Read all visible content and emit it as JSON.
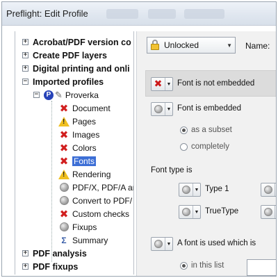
{
  "window": {
    "title": "Preflight: Edit Profile"
  },
  "tree": {
    "top_items": [
      {
        "label": "Acrobat/PDF version co",
        "expander": "+"
      },
      {
        "label": "Create PDF layers",
        "expander": "+"
      },
      {
        "label": "Digital printing and onli",
        "expander": "+"
      },
      {
        "label": "Imported profiles",
        "expander": "−"
      }
    ],
    "profile": {
      "label": "Proverka",
      "expander": "−"
    },
    "checks": [
      {
        "label": "Document",
        "icon": "x-icon"
      },
      {
        "label": "Pages",
        "icon": "warning-icon"
      },
      {
        "label": "Images",
        "icon": "x-icon"
      },
      {
        "label": "Colors",
        "icon": "x-icon"
      },
      {
        "label": "Fonts",
        "icon": "x-icon",
        "selected": true
      },
      {
        "label": "Rendering",
        "icon": "warning-icon"
      },
      {
        "label": "PDF/X, PDF/A ar",
        "icon": "grey-dot-icon"
      },
      {
        "label": "Convert to PDF/",
        "icon": "grey-dot-icon"
      },
      {
        "label": "Custom checks",
        "icon": "x-icon"
      },
      {
        "label": "Fixups",
        "icon": "grey-dot-icon"
      },
      {
        "label": "Summary",
        "icon": "summary-icon"
      }
    ],
    "bottom_items": [
      {
        "label": "PDF analysis",
        "expander": "+"
      },
      {
        "label": "PDF fixups",
        "expander": "+"
      }
    ]
  },
  "panel": {
    "lock_select": "Unlocked",
    "name_label": "Name:",
    "font_not_embedded": "Font is not embedded",
    "font_embedded": "Font is embedded",
    "as_subset": "as a subset",
    "completely": "completely",
    "font_type_heading": "Font type is",
    "type1": "Type 1",
    "truetype": "TrueType",
    "font_used_list": "A font is used which is",
    "in_this_list": "in this list"
  },
  "colors": {
    "selection": "#3d6fd6",
    "error": "#d11f1f",
    "warning": "#f0c020"
  }
}
